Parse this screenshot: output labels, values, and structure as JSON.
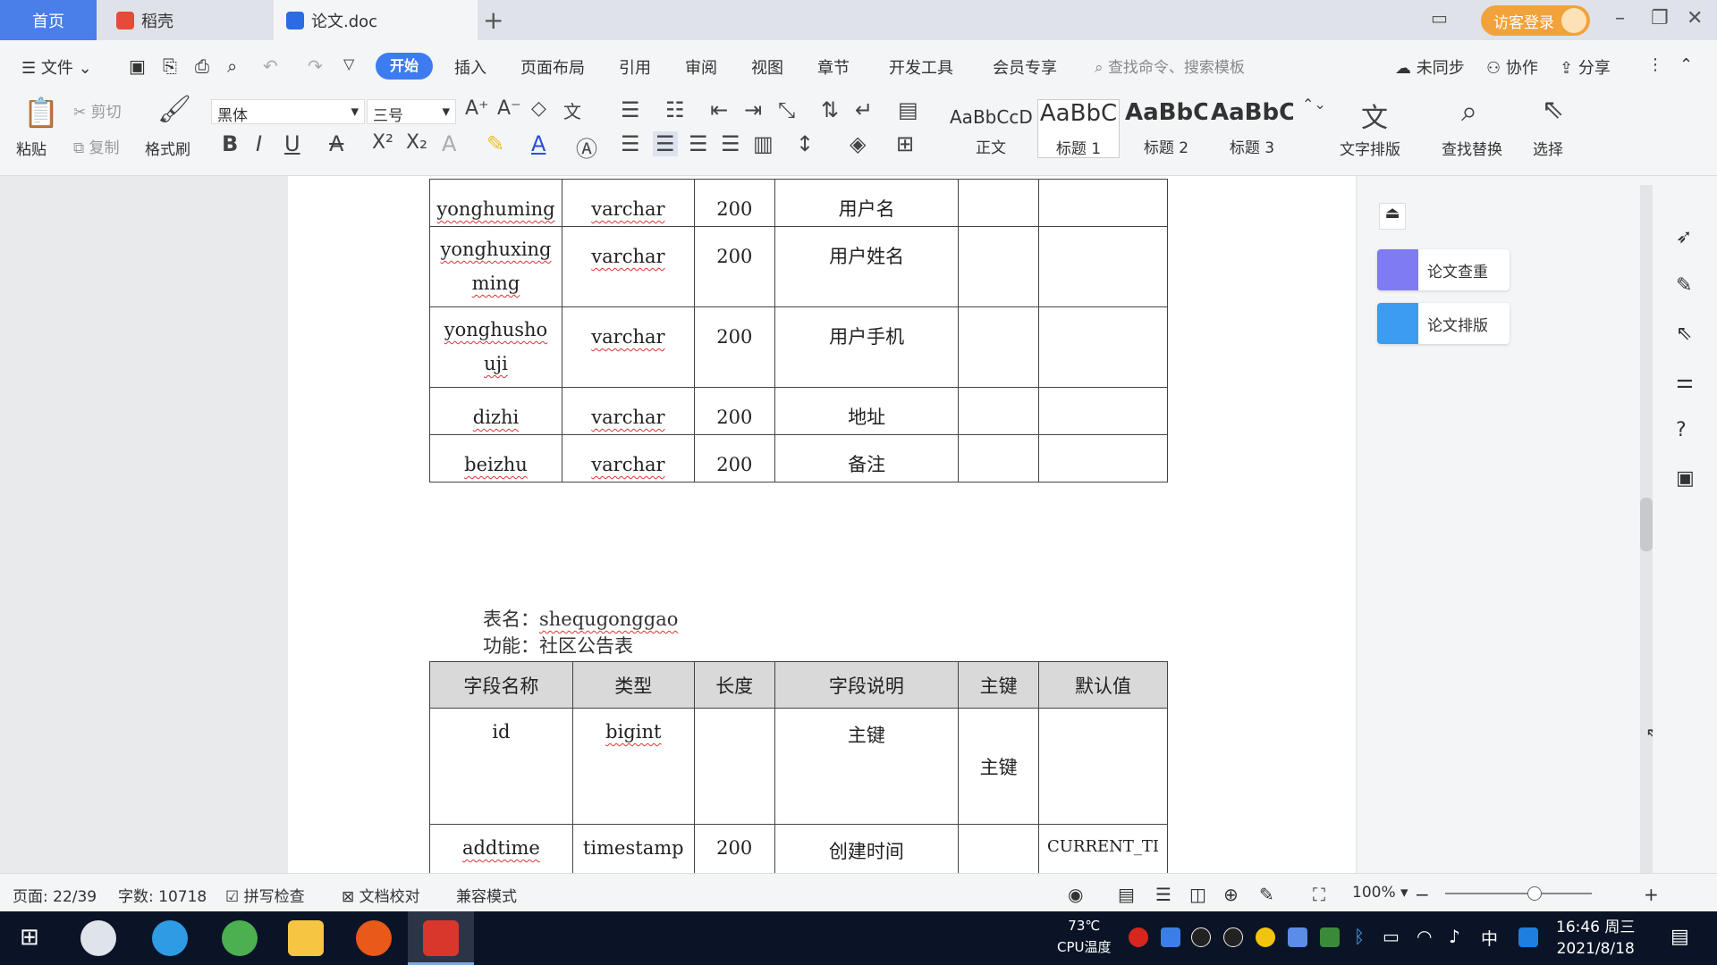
{
  "tabs": {
    "home": "首页",
    "daoke": "稻壳",
    "doc": "论文.doc",
    "new_tab": "+"
  },
  "titlebar": {
    "login": "访客登录"
  },
  "menu": {
    "file": "文件",
    "start": "开始",
    "insert": "插入",
    "layout": "页面布局",
    "ref": "引用",
    "review": "审阅",
    "view": "视图",
    "chapter": "章节",
    "dev": "开发工具",
    "vip": "会员专享",
    "search": "查找命令、搜索模板",
    "sync": "未同步",
    "collab": "协作",
    "share": "分享"
  },
  "ribbon": {
    "paste": "粘贴",
    "cut": "剪切",
    "copy": "复制",
    "format_painter": "格式刷",
    "font": "黑体",
    "size": "三号",
    "styles": [
      {
        "sample": "AaBbCcDd",
        "label": "正文"
      },
      {
        "sample": "AaBbC",
        "label": "标题 1"
      },
      {
        "sample": "AaBbC",
        "label": "标题 2"
      },
      {
        "sample": "AaBbC",
        "label": "标题 3"
      }
    ],
    "text_layout": "文字排版",
    "find_replace": "查找替换",
    "select": "选择"
  },
  "table1": {
    "rows": [
      [
        "yonghuming",
        "varchar",
        "200",
        "用户名",
        "",
        ""
      ],
      [
        "yonghuxingming",
        "varchar",
        "200",
        "用户姓名",
        "",
        ""
      ],
      [
        "yonghushouji",
        "varchar",
        "200",
        "用户手机",
        "",
        ""
      ],
      [
        "dizhi",
        "varchar",
        "200",
        "地址",
        "",
        ""
      ],
      [
        "beizhu",
        "varchar",
        "200",
        "备注",
        "",
        ""
      ]
    ]
  },
  "table2_meta": {
    "name_label": "表名：",
    "name": "shequgonggao",
    "func_label": "功能：",
    "func": "社区公告表"
  },
  "table2": {
    "headers": [
      "字段名称",
      "类型",
      "长度",
      "字段说明",
      "主键",
      "默认值"
    ],
    "rows": [
      [
        "id",
        "bigint",
        "",
        "主键",
        "主键",
        ""
      ],
      [
        "addtime",
        "timestamp",
        "200",
        "创建时间",
        "",
        "CURRENT_TI"
      ]
    ]
  },
  "right_panel": {
    "check": "论文查重",
    "format": "论文排版"
  },
  "status": {
    "page": "页面: 22/39",
    "words": "字数: 10718",
    "spell": "拼写检查",
    "proof": "文档校对",
    "compat": "兼容模式",
    "zoom": "100%"
  },
  "taskbar": {
    "time": "16:46 周三",
    "date": "2021/8/18",
    "cpu": "73℃",
    "cpu_label": "CPU温度",
    "ime": "中"
  },
  "colors": {
    "accent": "#3d7cf0",
    "login": "#f2a23a",
    "taskbar": "#0b1426"
  }
}
